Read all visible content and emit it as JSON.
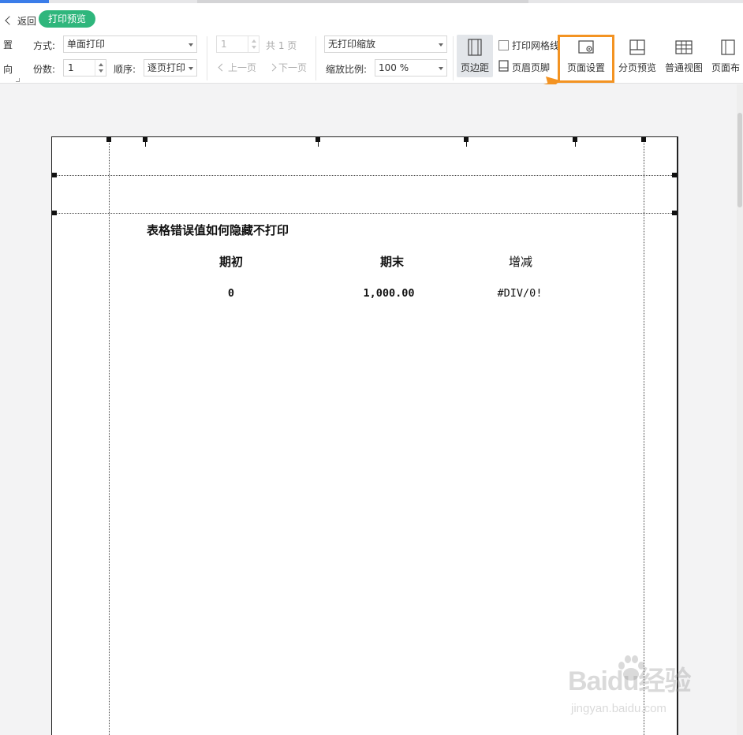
{
  "header": {
    "back_label": "返回",
    "mode_label": "打印预览"
  },
  "print_settings": {
    "partial_left_top": "置",
    "partial_left_bottom": "向",
    "method_label": "方式:",
    "method_value": "单面打印",
    "copies_label": "份数:",
    "copies_value": "1",
    "order_label": "顺序:",
    "order_value": "逐页打印"
  },
  "page_nav": {
    "page_value": "1",
    "total_label": "共 1 页",
    "prev_label": "上一页",
    "next_label": "下一页"
  },
  "scaling": {
    "scale_mode_value": "无打印缩放",
    "zoom_label": "缩放比例:",
    "zoom_value": "100 %"
  },
  "ribbon": {
    "margins_label": "页边距",
    "gridlines_label": "打印网格线",
    "gridlines_checked": false,
    "header_footer_label": "页眉页脚",
    "page_setup_label": "页面设置",
    "page_break_label": "分页预览",
    "normal_view_label": "普通视图",
    "page_layout_label": "页面布"
  },
  "sheet": {
    "title": "表格错误值如何隐藏不打印",
    "columns": [
      "期初",
      "期末",
      "增减"
    ],
    "row": [
      "0",
      "1,000.00",
      "#DIV/0!"
    ]
  },
  "watermark": {
    "main": "Baidu经验",
    "sub": "jingyan.baidu.com"
  },
  "colors": {
    "accent_green": "#2fb67c",
    "highlight_orange": "#f39322",
    "tab_blue": "#3b7de9"
  }
}
